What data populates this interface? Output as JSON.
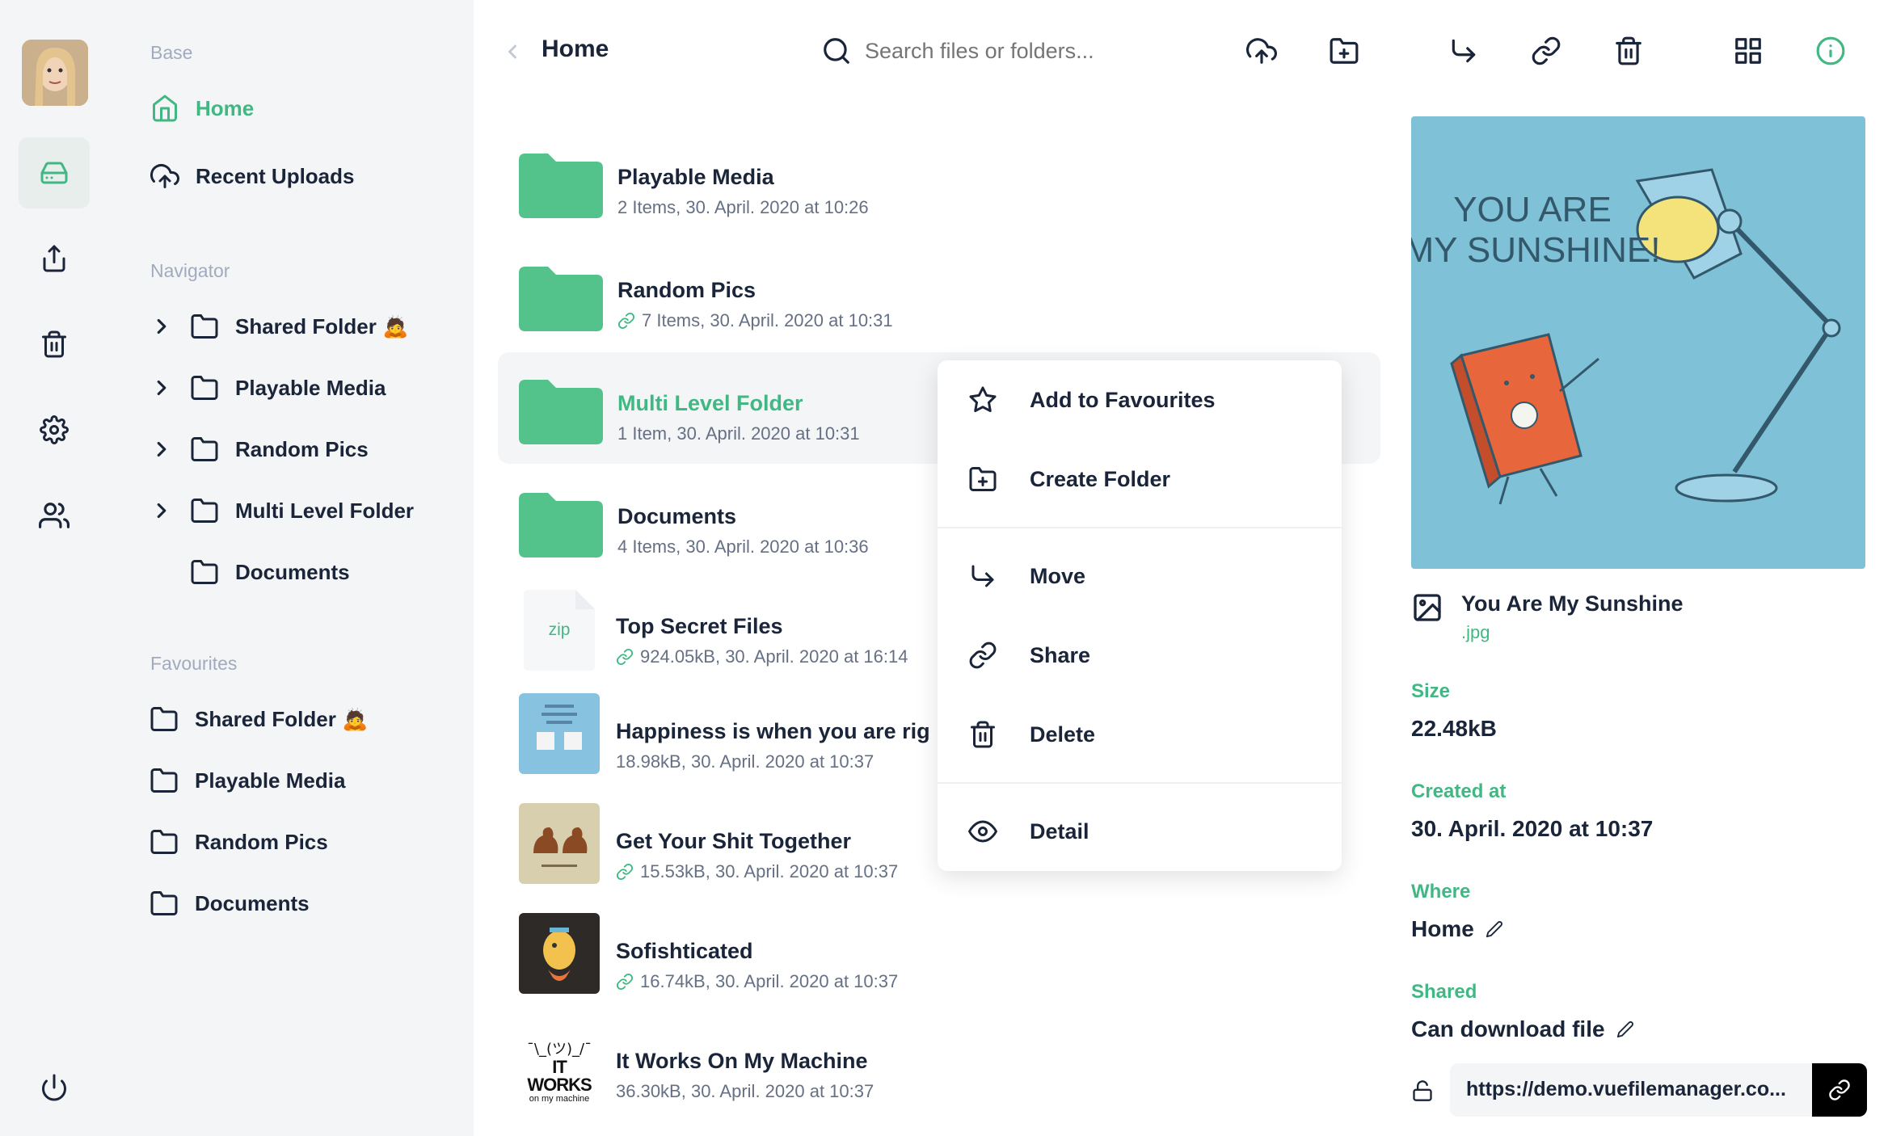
{
  "sidebar": {
    "sections": {
      "base": "Base",
      "navigator": "Navigator",
      "favourites": "Favourites"
    },
    "base_items": [
      {
        "label": "Home",
        "icon": "home-icon",
        "active": true
      },
      {
        "label": "Recent Uploads",
        "icon": "upload-cloud-icon"
      }
    ],
    "navigator_items": [
      {
        "label": "Shared Folder 🙇",
        "expandable": true
      },
      {
        "label": "Playable Media",
        "expandable": true
      },
      {
        "label": "Random Pics",
        "expandable": true
      },
      {
        "label": "Multi Level Folder",
        "expandable": true
      },
      {
        "label": "Documents",
        "expandable": false
      }
    ],
    "favourite_items": [
      {
        "label": "Shared Folder 🙇"
      },
      {
        "label": "Playable Media"
      },
      {
        "label": "Random Pics"
      },
      {
        "label": "Documents"
      }
    ]
  },
  "header": {
    "title": "Home",
    "search_placeholder": "Search files or folders..."
  },
  "files": [
    {
      "name": "Playable Media",
      "meta": "2 Items, 30. April. 2020 at 10:26",
      "type": "folder",
      "shared": false
    },
    {
      "name": "Random Pics",
      "meta": "7 Items, 30. April. 2020 at 10:31",
      "type": "folder",
      "shared": true
    },
    {
      "name": "Multi Level Folder",
      "meta": "1 Item, 30. April. 2020 at 10:31",
      "type": "folder",
      "shared": false,
      "selected": true
    },
    {
      "name": "Documents",
      "meta": "4 Items, 30. April. 2020 at 10:36",
      "type": "folder",
      "shared": false
    },
    {
      "name": "Top Secret Files",
      "meta": "924.05kB, 30. April. 2020 at 16:14",
      "type": "zip",
      "ext": "zip",
      "shared": true
    },
    {
      "name": "Happiness is when you are rig",
      "meta": "18.98kB, 30. April. 2020 at 10:37",
      "type": "image",
      "shared": false
    },
    {
      "name": "Get Your Shit Together",
      "meta": "15.53kB, 30. April. 2020 at 10:37",
      "type": "image",
      "shared": true
    },
    {
      "name": "Sofishticated",
      "meta": "16.74kB, 30. April. 2020 at 10:37",
      "type": "image",
      "shared": true
    },
    {
      "name": "It Works On My Machine",
      "meta": "36.30kB, 30. April. 2020 at 10:37",
      "type": "image",
      "shared": false
    }
  ],
  "thumb_texts": {
    "works_shrug": "¯\\_(ツ)_/¯",
    "works_big": "IT WORKS",
    "works_small": "on my machine"
  },
  "context_menu": {
    "add_favourites": "Add to Favourites",
    "create_folder": "Create Folder",
    "move": "Move",
    "share": "Share",
    "delete": "Delete",
    "detail": "Detail"
  },
  "detail": {
    "preview_text_1": "YOU ARE",
    "preview_text_2": "MY SUNSHINE!",
    "file_name": "You Are My Sunshine",
    "file_ext": ".jpg",
    "size_label": "Size",
    "size_value": "22.48kB",
    "created_label": "Created at",
    "created_value": "30. April. 2020 at 10:37",
    "where_label": "Where",
    "where_value": "Home",
    "shared_label": "Shared",
    "shared_value": "Can download file",
    "share_url": "https://demo.vuefilemanager.co..."
  },
  "colors": {
    "accent": "#41b883",
    "text": "#1b2539",
    "muted": "#667085",
    "sidebar_bg": "#f4f5f6",
    "preview_bg": "#7fc1d6"
  }
}
